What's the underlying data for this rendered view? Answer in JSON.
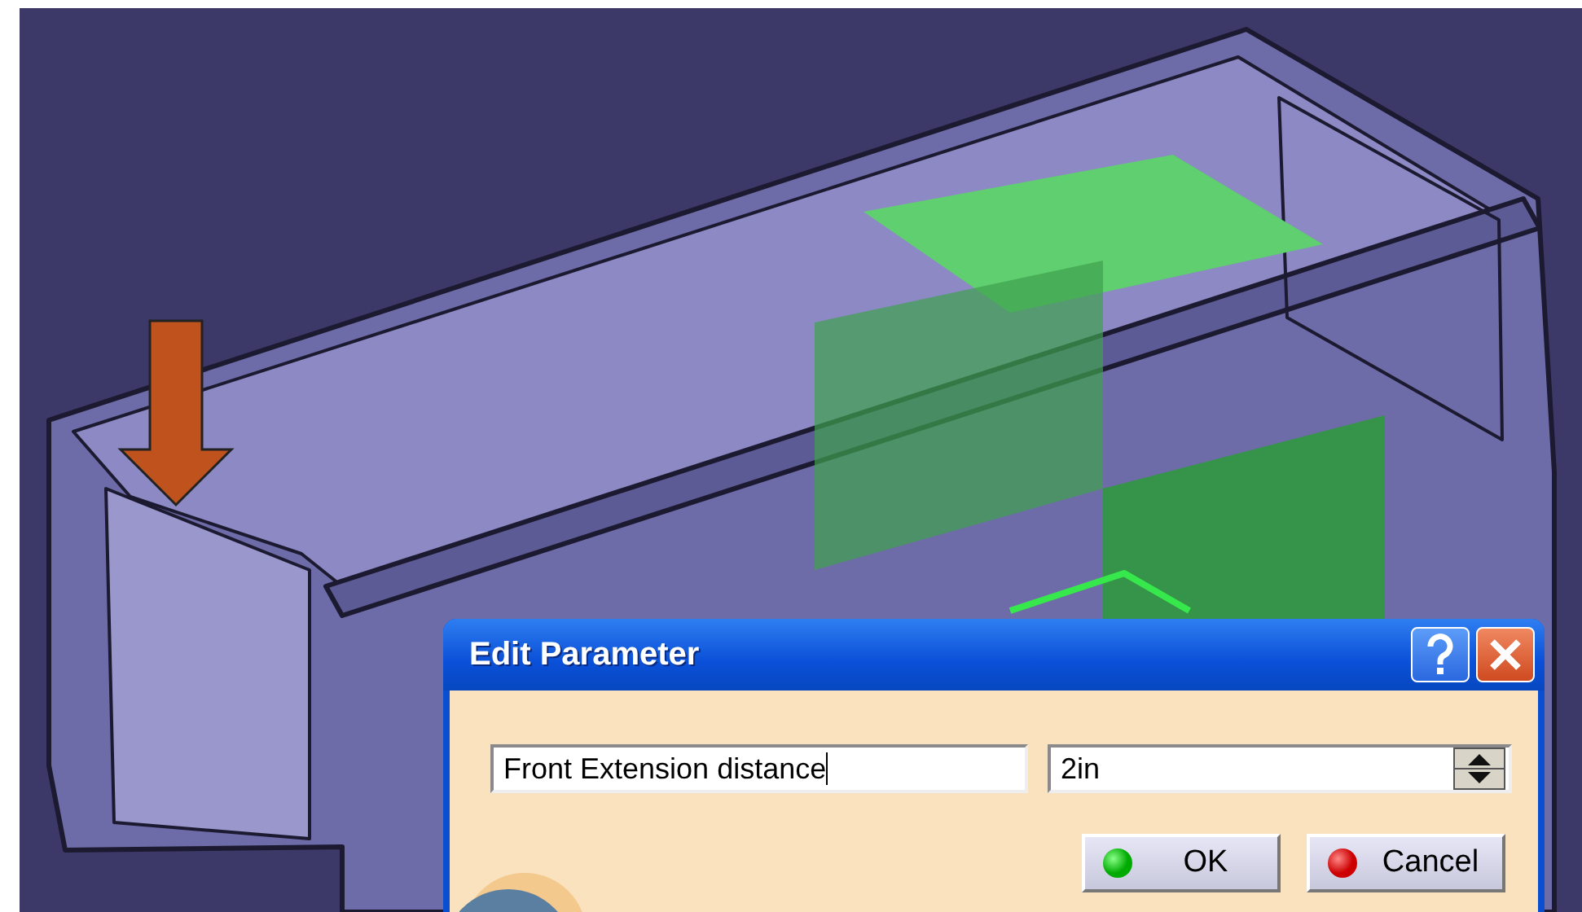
{
  "dialog": {
    "title": "Edit Parameter",
    "name_field": {
      "value": "Front Extension distance"
    },
    "value_field": {
      "value": "2in"
    },
    "buttons": [
      {
        "kind": "ok",
        "label": "OK"
      },
      {
        "kind": "cancel",
        "label": "Cancel"
      }
    ]
  }
}
